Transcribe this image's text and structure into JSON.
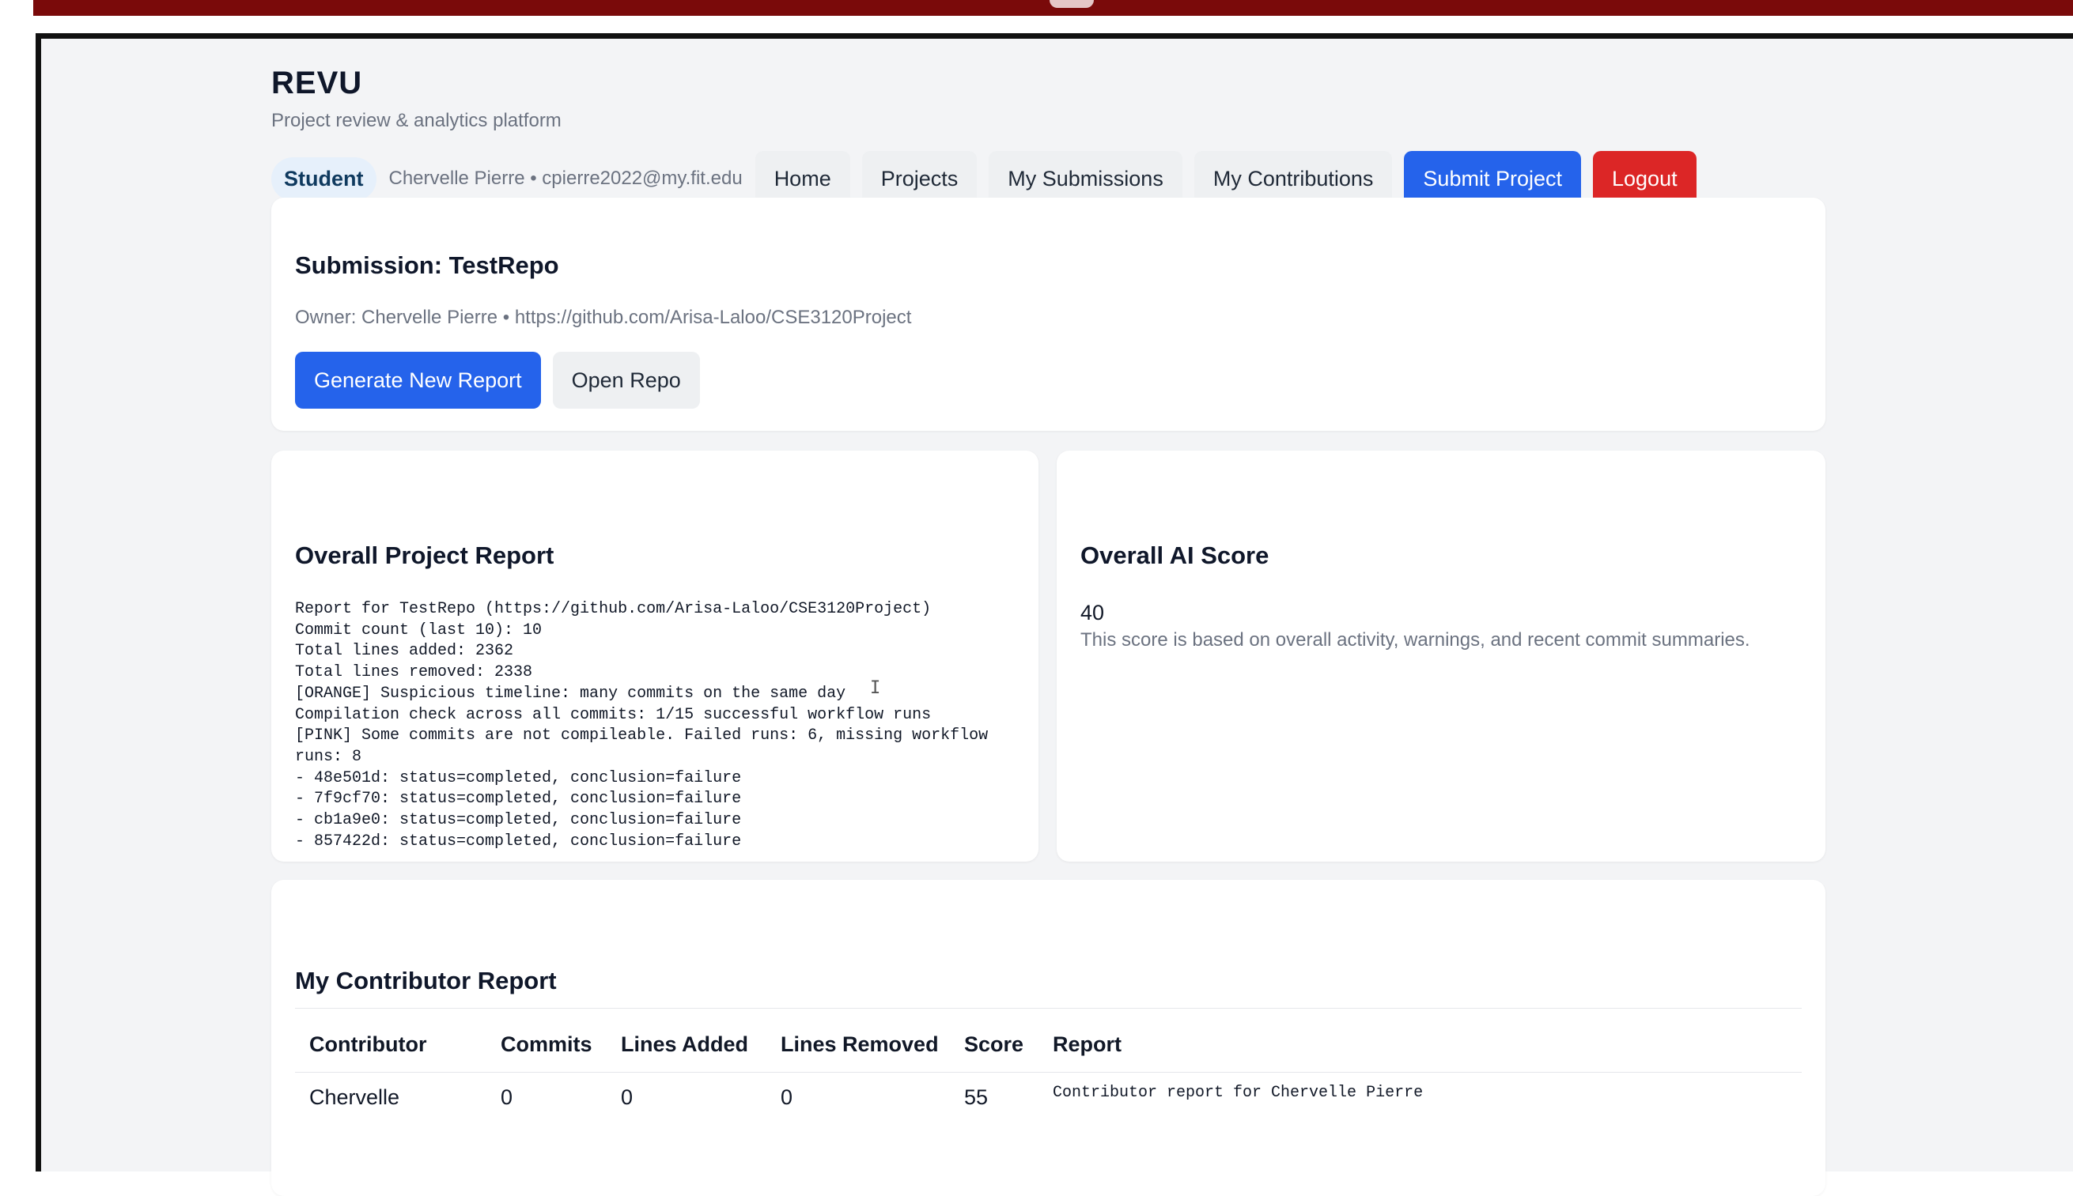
{
  "app": {
    "title": "REVU",
    "subtitle": "Project review & analytics platform"
  },
  "nav": {
    "role": "Student",
    "user": "Chervelle Pierre • cpierre2022@my.fit.edu",
    "home": "Home",
    "projects": "Projects",
    "my_submissions": "My Submissions",
    "my_contributions": "My Contributions",
    "submit_project": "Submit Project",
    "logout": "Logout"
  },
  "submission": {
    "title": "Submission: TestRepo",
    "owner_line": "Owner: Chervelle Pierre • https://github.com/Arisa-Laloo/CSE3120Project",
    "generate_button": "Generate New Report",
    "open_repo_button": "Open Repo"
  },
  "overall_report": {
    "title": "Overall Project Report",
    "text": "Report for TestRepo (https://github.com/Arisa-Laloo/CSE3120Project)\nCommit count (last 10): 10\nTotal lines added: 2362\nTotal lines removed: 2338\n[ORANGE] Suspicious timeline: many commits on the same day\nCompilation check across all commits: 1/15 successful workflow runs\n[PINK] Some commits are not compileable. Failed runs: 6, missing workflow runs: 8\n- 48e501d: status=completed, conclusion=failure\n- 7f9cf70: status=completed, conclusion=failure\n- cb1a9e0: status=completed, conclusion=failure\n- 857422d: status=completed, conclusion=failure"
  },
  "ai_score": {
    "title": "Overall AI Score",
    "value": "40",
    "note": "This score is based on overall activity, warnings, and recent commit summaries."
  },
  "contributor_report": {
    "title": "My Contributor Report",
    "columns": {
      "contributor": "Contributor",
      "commits": "Commits",
      "lines_added": "Lines Added",
      "lines_removed": "Lines Removed",
      "score": "Score",
      "report": "Report"
    },
    "rows": [
      {
        "contributor": "Chervelle",
        "commits": "0",
        "lines_added": "0",
        "lines_removed": "0",
        "score": "55",
        "report": "Contributor report for Chervelle Pierre"
      }
    ]
  },
  "colors": {
    "primary": "#2563eb",
    "danger": "#dc2626",
    "top_bar": "#7a0a0a"
  }
}
